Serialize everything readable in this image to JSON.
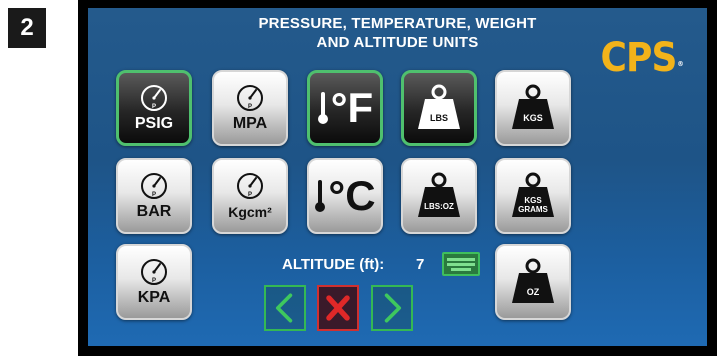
{
  "step_number": "2",
  "screen": {
    "title_line1": "PRESSURE, TEMPERATURE, WEIGHT",
    "title_line2": "AND ALTITUDE UNITS",
    "logo_text": "CPS",
    "logo_mark": "®"
  },
  "pressure_units": [
    {
      "label": "PSIG",
      "icon": "pressure-gauge-icon",
      "selected": true
    },
    {
      "label": "MPA",
      "icon": "pressure-gauge-icon",
      "selected": false
    },
    {
      "label": "BAR",
      "icon": "pressure-gauge-icon",
      "selected": false
    },
    {
      "label": "Kgcm²",
      "icon": "pressure-gauge-icon",
      "selected": false
    },
    {
      "label": "KPA",
      "icon": "pressure-gauge-icon",
      "selected": false
    }
  ],
  "temperature_units": [
    {
      "label": "°F",
      "icon": "thermometer-icon",
      "selected": true
    },
    {
      "label": "°C",
      "icon": "thermometer-icon",
      "selected": false
    }
  ],
  "weight_units": [
    {
      "label": "LBS",
      "icon": "weight-icon",
      "selected": true
    },
    {
      "label": "KGS",
      "icon": "weight-icon",
      "selected": false
    },
    {
      "label": "LBS:OZ",
      "icon": "weight-icon",
      "selected": false
    },
    {
      "label_line1": "KGS",
      "label_line2": "GRAMS",
      "icon": "weight-icon",
      "selected": false
    },
    {
      "label": "OZ",
      "icon": "weight-icon",
      "selected": false
    }
  ],
  "gauge_marker": "P",
  "altitude": {
    "label": "ALTITUDE (ft):",
    "value": "7",
    "keyboard_icon": "keyboard-icon"
  },
  "navigation": {
    "back_icon": "chevron-left-icon",
    "cancel_icon": "close-icon",
    "forward_icon": "chevron-right-icon"
  },
  "colors": {
    "screen_blue": "#1e5487",
    "selected_outline": "#4fc06e",
    "logo_gold": "#f2b31a",
    "cancel_red": "#d03030",
    "nav_green": "#34b854"
  }
}
